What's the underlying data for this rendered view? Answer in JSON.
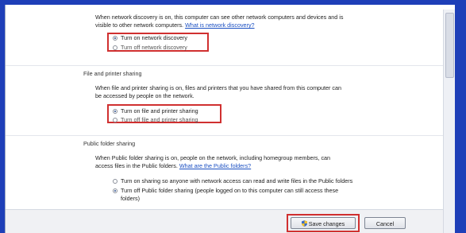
{
  "network_discovery": {
    "description_line1": "When network discovery is on, this computer can see other network computers and devices and is",
    "description_line2": "visible to other network computers.",
    "link": "What is network discovery?",
    "option_on": "Turn on network discovery",
    "option_off": "Turn off network discovery"
  },
  "file_printer_sharing": {
    "title": "File and printer sharing",
    "description_line1": "When file and printer sharing is on, files and printers that you have shared from this computer can",
    "description_line2": "be accessed by people on the network.",
    "option_on": "Turn on file and printer sharing",
    "option_off": "Turn off file and printer sharing"
  },
  "public_folder_sharing": {
    "title": "Public folder sharing",
    "description_line1": "When Public folder sharing is on, people on the network, including homegroup members, can",
    "description_line2": "access files in the Public folders.",
    "link": "What are the Public folders?",
    "option_on": "Turn on sharing so anyone with network access can read and write files in the Public folders",
    "option_off_line1": "Turn off Public folder sharing (people logged on to this computer can still access these",
    "option_off_line2": "folders)"
  },
  "footer": {
    "save_label": "Save changes",
    "cancel_label": "Cancel"
  },
  "colors": {
    "highlight": "#d03030",
    "link": "#1a4fc2",
    "background_frame": "#1e3fb8"
  }
}
